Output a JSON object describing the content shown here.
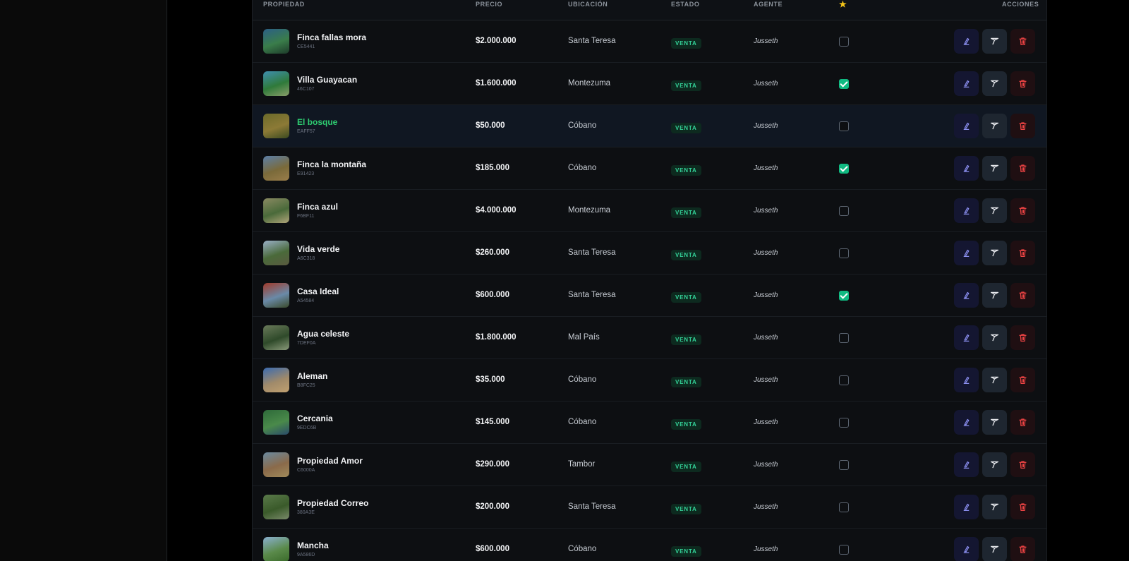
{
  "table": {
    "headers": {
      "property": "PROPIEDAD",
      "price": "PRECIO",
      "location": "UBICACIÓN",
      "status": "ESTADO",
      "agent": "AGENTE",
      "featured": "★",
      "actions": "ACCIONES"
    },
    "rows": [
      {
        "name": "Finca fallas mora",
        "code": "CE5441",
        "price": "$2.000.000",
        "location": "Santa Teresa",
        "status": "VENTA",
        "agent": "Jusseth",
        "featured": false
      },
      {
        "name": "Villa Guayacan",
        "code": "46C107",
        "price": "$1.600.000",
        "location": "Montezuma",
        "status": "VENTA",
        "agent": "Jusseth",
        "featured": true
      },
      {
        "name": "El bosque",
        "code": "EAFF57",
        "price": "$50.000",
        "location": "Cóbano",
        "status": "VENTA",
        "agent": "Jusseth",
        "featured": false
      },
      {
        "name": "Finca la montaña",
        "code": "E91423",
        "price": "$185.000",
        "location": "Cóbano",
        "status": "VENTA",
        "agent": "Jusseth",
        "featured": true
      },
      {
        "name": "Finca azul",
        "code": "F6BF11",
        "price": "$4.000.000",
        "location": "Montezuma",
        "status": "VENTA",
        "agent": "Jusseth",
        "featured": false
      },
      {
        "name": "Vida verde",
        "code": "A6C318",
        "price": "$260.000",
        "location": "Santa Teresa",
        "status": "VENTA",
        "agent": "Jusseth",
        "featured": false
      },
      {
        "name": "Casa Ideal",
        "code": "A54584",
        "price": "$600.000",
        "location": "Santa Teresa",
        "status": "VENTA",
        "agent": "Jusseth",
        "featured": true
      },
      {
        "name": "Agua celeste",
        "code": "7DEF0A",
        "price": "$1.800.000",
        "location": "Mal País",
        "status": "VENTA",
        "agent": "Jusseth",
        "featured": false
      },
      {
        "name": "Aleman",
        "code": "B8FC25",
        "price": "$35.000",
        "location": "Cóbano",
        "status": "VENTA",
        "agent": "Jusseth",
        "featured": false
      },
      {
        "name": "Cercania",
        "code": "9EDC6B",
        "price": "$145.000",
        "location": "Cóbano",
        "status": "VENTA",
        "agent": "Jusseth",
        "featured": false
      },
      {
        "name": "Propiedad Amor",
        "code": "C6000A",
        "price": "$290.000",
        "location": "Tambor",
        "status": "VENTA",
        "agent": "Jusseth",
        "featured": false
      },
      {
        "name": "Propiedad Correo",
        "code": "380A3E",
        "price": "$200.000",
        "location": "Santa Teresa",
        "status": "VENTA",
        "agent": "Jusseth",
        "featured": false
      },
      {
        "name": "Mancha",
        "code": "9A586D",
        "price": "$600.000",
        "location": "Cóbano",
        "status": "VENTA",
        "agent": "Jusseth",
        "featured": false
      }
    ]
  },
  "icons": {
    "edit": "pencil-ruler-icon",
    "move": "send-icon",
    "delete": "trash-icon"
  },
  "colors": {
    "status_badge": "#34d399",
    "featured_checked": "#10b981",
    "highlight_name": "#2ecc71",
    "star": "#f5c518",
    "delete_icon": "#ef4444",
    "edit_icon": "#8b8ff0"
  }
}
